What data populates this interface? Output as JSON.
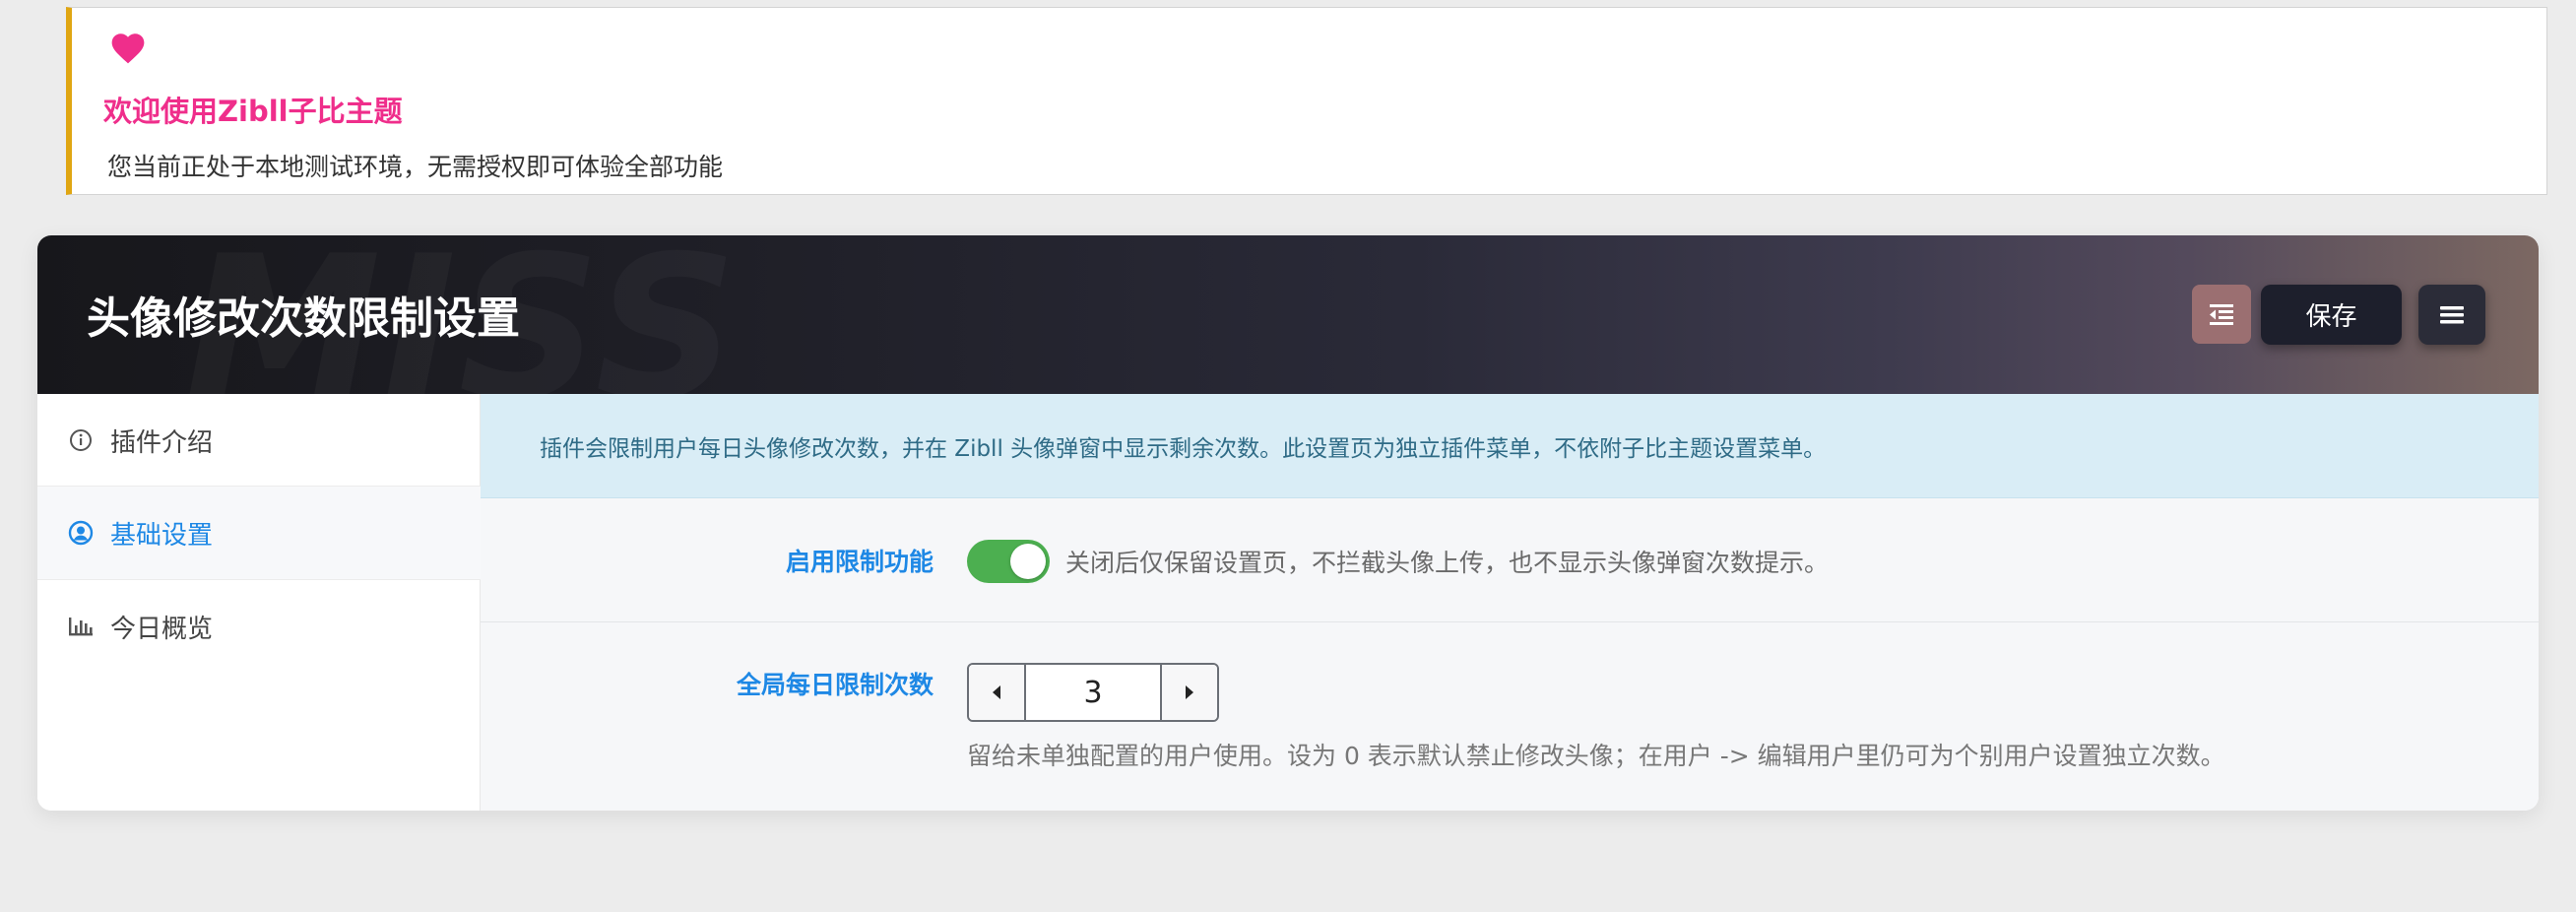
{
  "notice": {
    "icon": "heart-icon",
    "icon_color": "#ef2e8b",
    "title": "欢迎使用Zibll子比主题",
    "description": "您当前正处于本地测试环境，无需授权即可体验全部功能"
  },
  "header": {
    "watermark": "MISS",
    "title": "头像修改次数限制设置",
    "indent_icon": "indent-icon",
    "save_label": "保存",
    "menu_icon": "menu-icon"
  },
  "sidebar": {
    "items": [
      {
        "label": "插件介绍",
        "icon": "info-icon",
        "active": false
      },
      {
        "label": "基础设置",
        "icon": "user-circle-icon",
        "active": true
      },
      {
        "label": "今日概览",
        "icon": "bar-chart-icon",
        "active": false
      }
    ]
  },
  "content": {
    "info": "插件会限制用户每日头像修改次数，并在 Zibll 头像弹窗中显示剩余次数。此设置页为独立插件菜单，不依附子比主题设置菜单。",
    "fields": {
      "enable": {
        "label": "启用限制功能",
        "value": true,
        "description": "关闭后仅保留设置页，不拦截头像上传，也不显示头像弹窗次数提示。"
      },
      "daily_limit": {
        "label": "全局每日限制次数",
        "value": "3",
        "description": "留给未单独配置的用户使用。设为 0 表示默认禁止修改头像；在用户 -> 编辑用户里仍可为个别用户设置独立次数。"
      }
    }
  },
  "colors": {
    "accent": "#1e88e5",
    "toggle_on": "#4caf50",
    "notice_border": "#e0a612",
    "notice_title": "#ef2e8b"
  }
}
